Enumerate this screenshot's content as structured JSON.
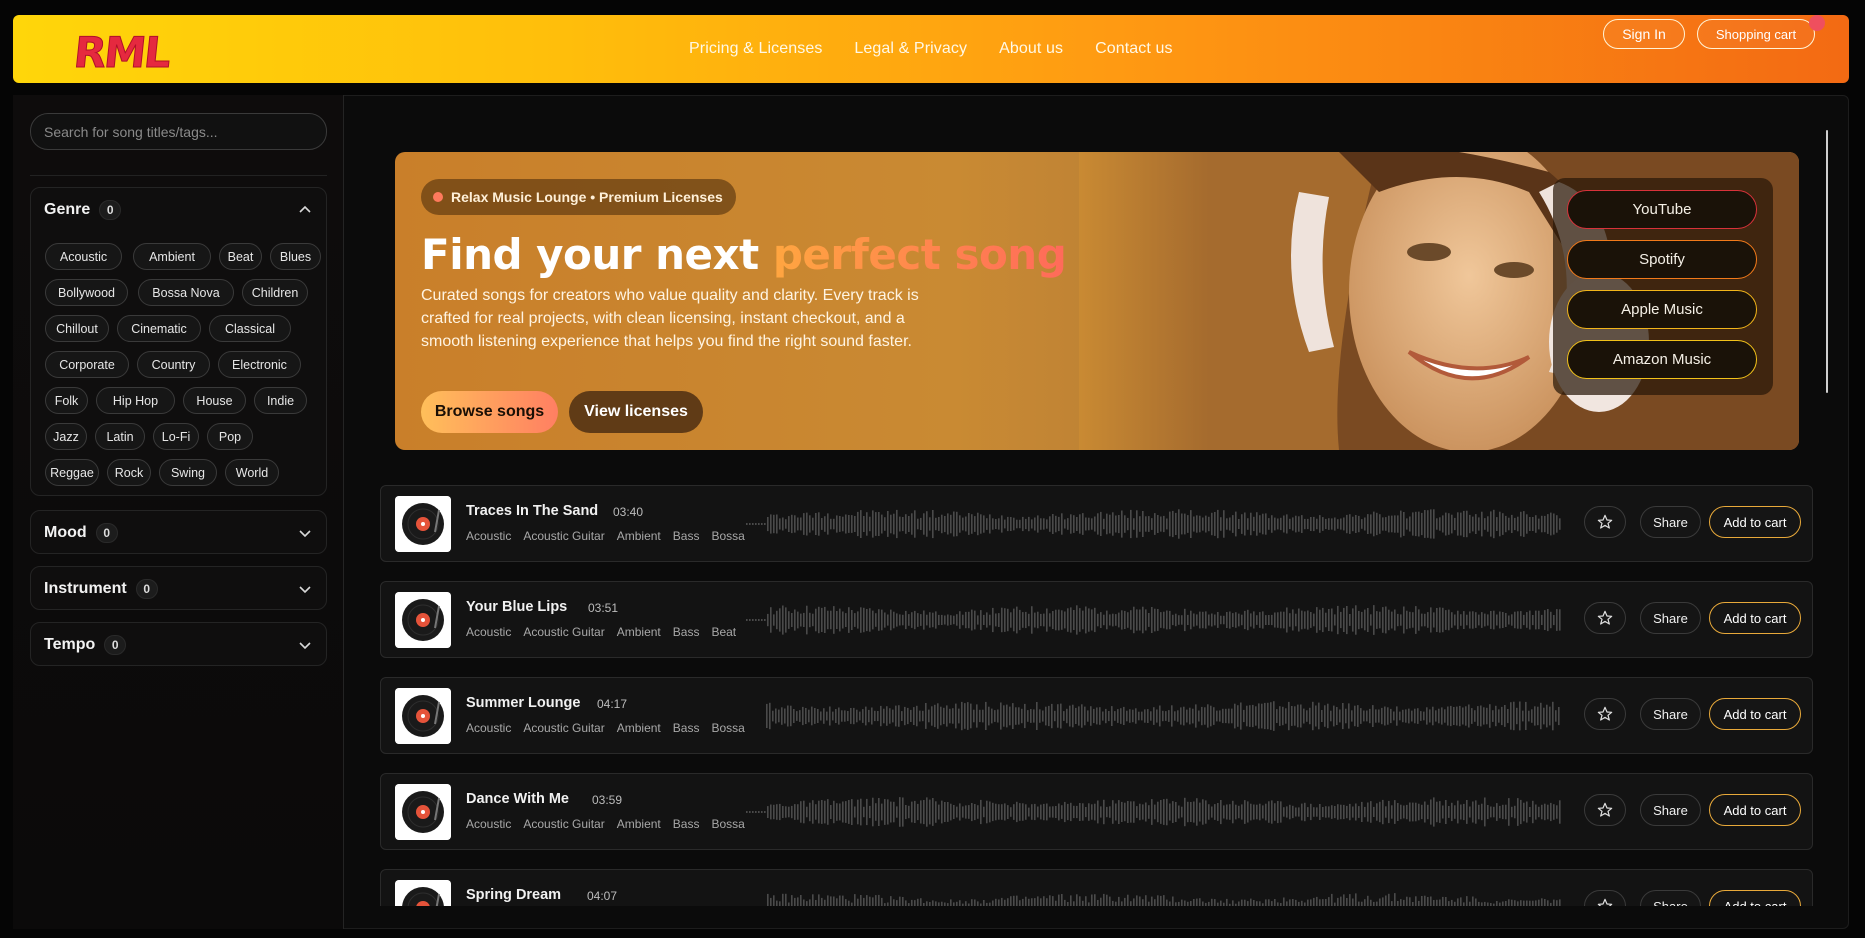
{
  "brand": {
    "logo_text": "RML"
  },
  "nav": [
    {
      "label": "Pricing & Licenses"
    },
    {
      "label": "Legal & Privacy"
    },
    {
      "label": "About us"
    },
    {
      "label": "Contact us"
    }
  ],
  "header": {
    "sign_in": "Sign In",
    "cart": "Shopping cart"
  },
  "search": {
    "placeholder": "Search for song titles/tags..."
  },
  "filters": {
    "genre": {
      "label": "Genre",
      "count": "0",
      "chips": [
        "Acoustic",
        "Ambient",
        "Beat",
        "Blues",
        "Bollywood",
        "Bossa Nova",
        "Children",
        "Chillout",
        "Cinematic",
        "Classical",
        "Corporate",
        "Country",
        "Electronic",
        "Folk",
        "Hip Hop",
        "House",
        "Indie",
        "Jazz",
        "Latin",
        "Lo-Fi",
        "Pop",
        "Reggae",
        "Rock",
        "Swing",
        "World"
      ]
    },
    "mood": {
      "label": "Mood",
      "count": "0"
    },
    "instrument": {
      "label": "Instrument",
      "count": "0"
    },
    "tempo": {
      "label": "Tempo",
      "count": "0"
    }
  },
  "hero": {
    "badge": "Relax Music Lounge • Premium Licenses",
    "title_lead": "Find your next ",
    "title_accent": "perfect song",
    "description": "Curated songs for creators who value quality and clarity. Every track is crafted for real projects, with clean licensing, instant checkout, and a smooth listening experience that helps you find the right sound faster.",
    "browse_label": "Browse songs",
    "licenses_label": "View licenses",
    "streaming": [
      {
        "label": "YouTube",
        "border": "#d8323a"
      },
      {
        "label": "Spotify",
        "border": "#f27a1a"
      },
      {
        "label": "Apple Music",
        "border": "#f2b51a"
      },
      {
        "label": "Amazon Music",
        "border": "#f2c21a"
      }
    ]
  },
  "tracks": [
    {
      "title": "Traces In The Sand",
      "duration": "03:40",
      "tags": [
        "Acoustic",
        "Acoustic Guitar",
        "Ambient",
        "Bass",
        "Bossa"
      ]
    },
    {
      "title": "Your Blue Lips",
      "duration": "03:51",
      "tags": [
        "Acoustic",
        "Acoustic Guitar",
        "Ambient",
        "Bass",
        "Beat"
      ]
    },
    {
      "title": "Summer Lounge",
      "duration": "04:17",
      "tags": [
        "Acoustic",
        "Acoustic Guitar",
        "Ambient",
        "Bass",
        "Bossa"
      ]
    },
    {
      "title": "Dance With Me",
      "duration": "03:59",
      "tags": [
        "Acoustic",
        "Acoustic Guitar",
        "Ambient",
        "Bass",
        "Bossa"
      ]
    },
    {
      "title": "Spring Dream",
      "duration": "04:07",
      "tags": []
    }
  ],
  "track_actions": {
    "share": "Share",
    "add_to_cart": "Add to cart"
  },
  "colors": {
    "accent": "#e8a93a",
    "header_start": "#ffd60a",
    "header_end": "#f36a13",
    "logo": "#e5293f"
  }
}
